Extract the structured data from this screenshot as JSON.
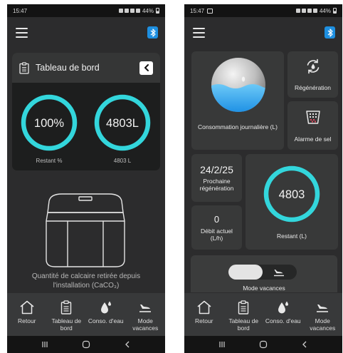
{
  "status_bar": {
    "time": "15:47",
    "battery": "44%"
  },
  "dashboard": {
    "title": "Tableau de bord",
    "gauges": [
      {
        "value": "100%",
        "caption": "Restant %"
      },
      {
        "value": "4803L",
        "caption": "4803 L"
      }
    ],
    "removed_caption_line1": "Quantité de calcaire retirée depuis",
    "removed_caption_line2": "l'installation (CaCO₃)"
  },
  "tiles": {
    "daily_consumption": "Consommation journalière (L)",
    "regeneration": "Régénération",
    "salt_alarm": "Alarme de sel",
    "next_regen_date": "24/2/25",
    "next_regen_label": "Prochaine régénération",
    "flow_value": "0",
    "flow_label": "Débit actuel (L/h)",
    "remaining_value": "4803",
    "remaining_label": "Restant (L)",
    "vacation_label": "Mode vacances"
  },
  "bottom_nav": [
    {
      "label": "Retour",
      "icon": "home-icon"
    },
    {
      "label": "Tableau de bord",
      "icon": "clipboard-icon"
    },
    {
      "label": "Conso. d'eau",
      "icon": "water-drop-icon"
    },
    {
      "label": "Mode vacances",
      "icon": "airplane-landing-icon"
    }
  ],
  "colors": {
    "accent_cyan": "#33d6dc",
    "water_blue": "#27a8ee",
    "bluetooth_blue": "#1e8fe0",
    "background": "#2c2c2d",
    "card": "#1d1e1e"
  }
}
